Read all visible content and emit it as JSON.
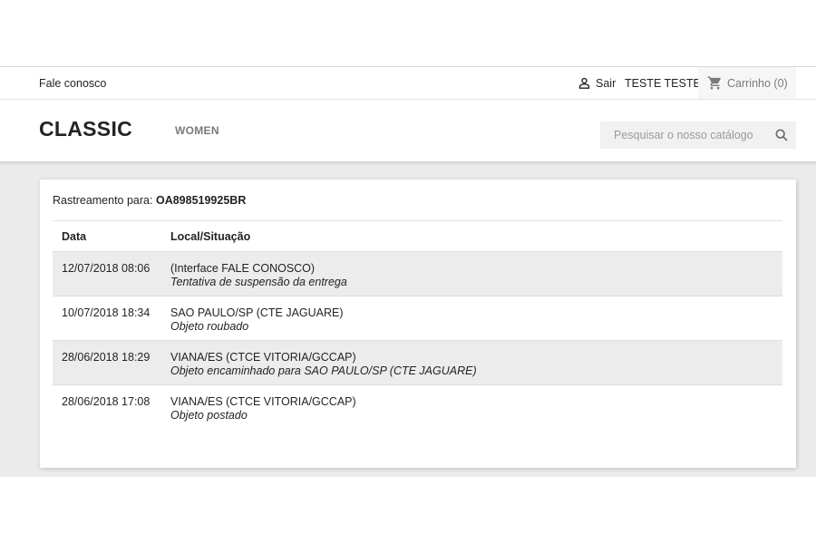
{
  "nav": {
    "contact_label": "Fale conosco",
    "signout_label": "Sair",
    "user_name": "TESTE TESTE",
    "cart_label": "Carrinho",
    "cart_count": "(0)"
  },
  "header": {
    "logo": "CLASSIC",
    "menu_women": "WOMEN",
    "search_placeholder": "Pesquisar o nosso catálogo"
  },
  "tracking": {
    "label": "Rastreamento para:",
    "code": "OA898519925BR",
    "columns": {
      "date": "Data",
      "location": "Local/Situação"
    },
    "events": [
      {
        "date": "12/07/2018 08:06",
        "location": "(Interface FALE CONOSCO)",
        "status": "Tentativa de suspensão da entrega"
      },
      {
        "date": "10/07/2018 18:34",
        "location": "SAO PAULO/SP (CTE JAGUARE)",
        "status": "Objeto roubado"
      },
      {
        "date": "28/06/2018 18:29",
        "location": "VIANA/ES (CTCE VITORIA/GCCAP)",
        "status": "Objeto encaminhado para SAO PAULO/SP (CTE JAGUARE)"
      },
      {
        "date": "28/06/2018 17:08",
        "location": "VIANA/ES (CTCE VITORIA/GCCAP)",
        "status": "Objeto postado"
      }
    ]
  },
  "icons": {
    "user": "user-icon",
    "cart": "cart-icon",
    "search": "search-icon"
  },
  "colors": {
    "page_background": "#ebebeb",
    "muted_text": "#7a7a7a",
    "striped_row": "#ececec"
  }
}
